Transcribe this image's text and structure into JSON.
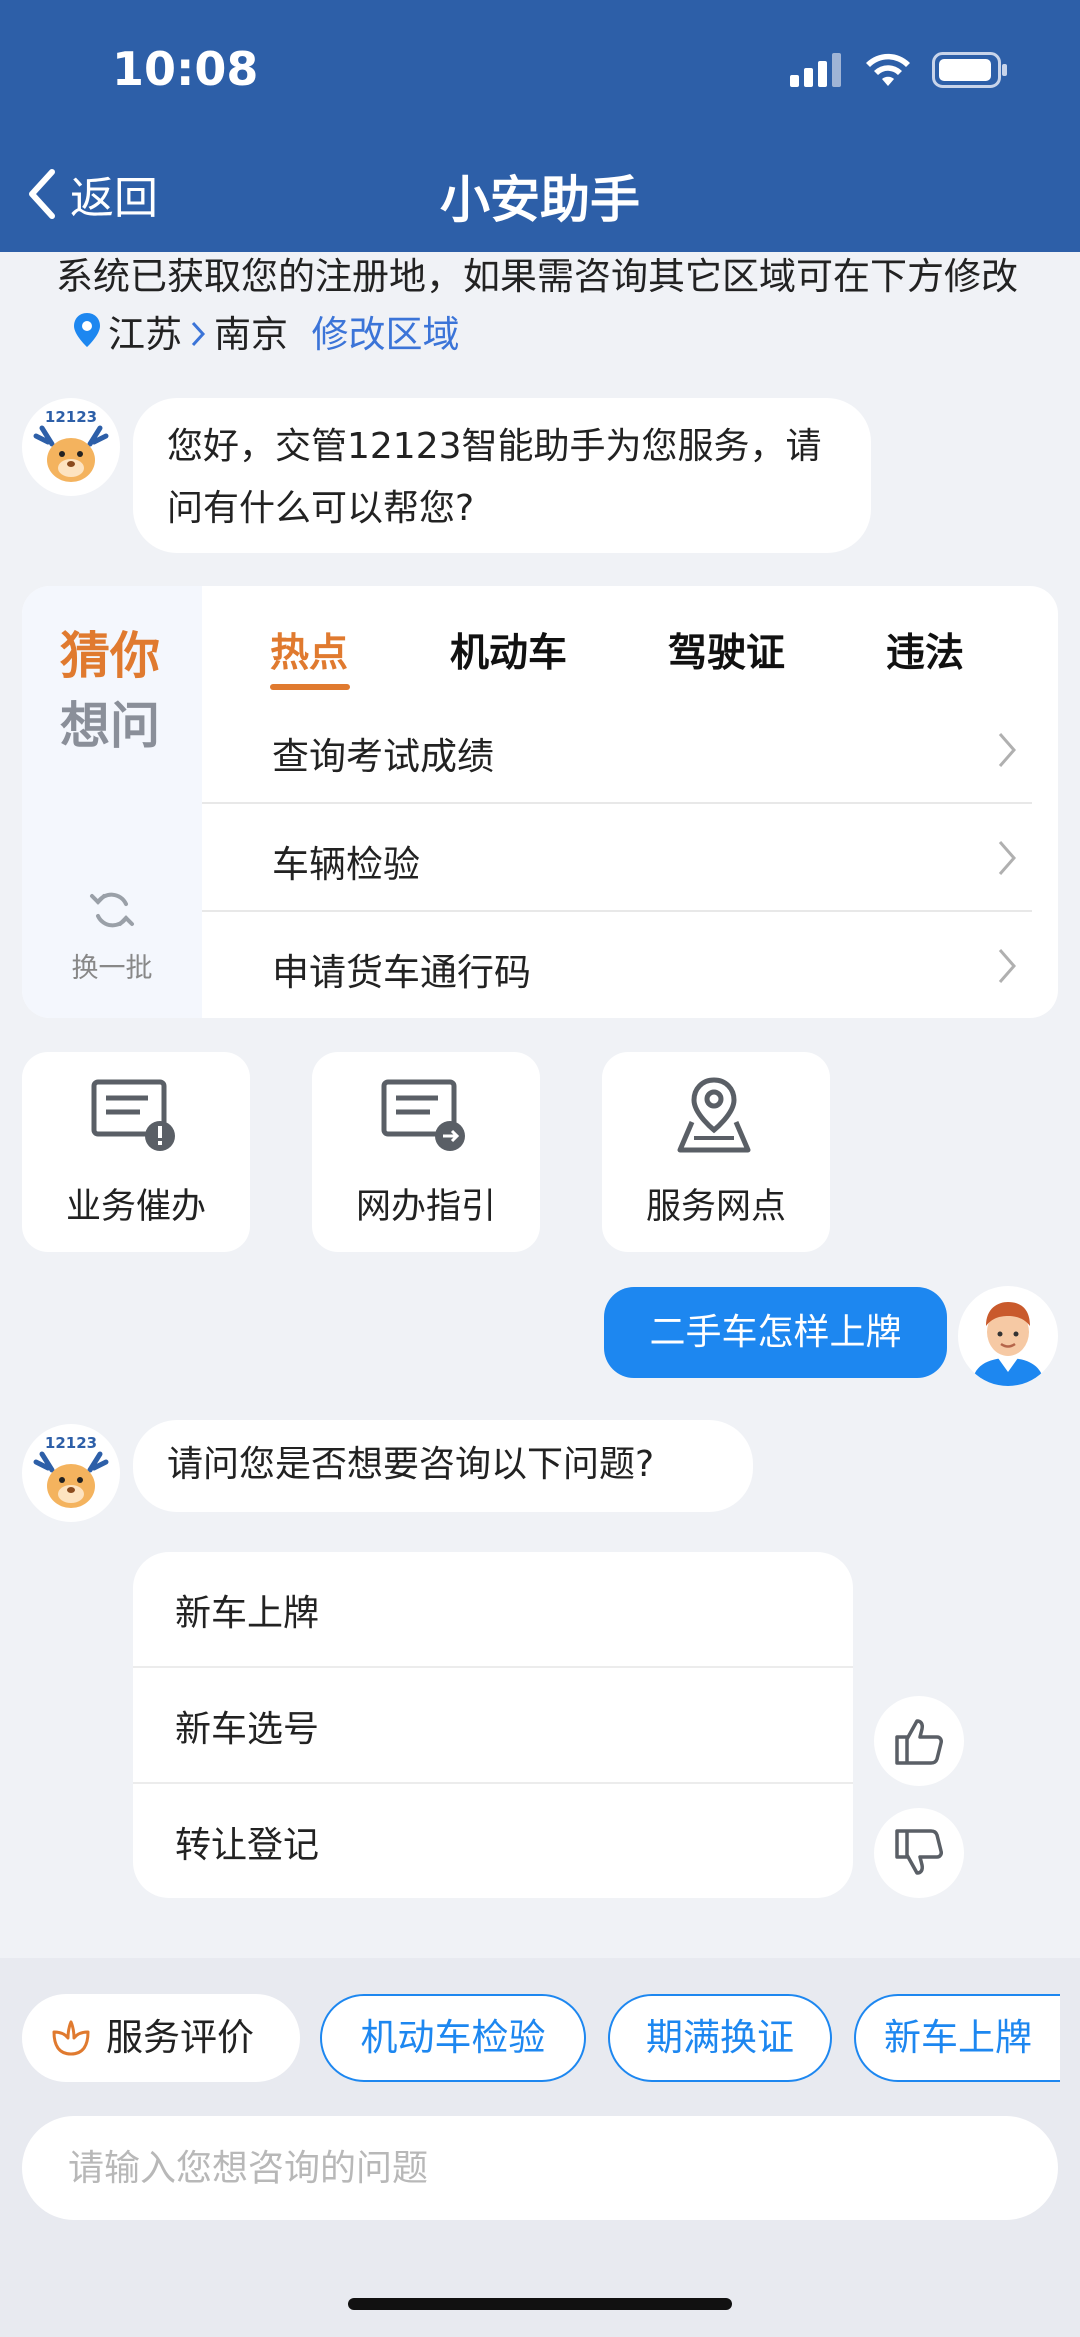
{
  "status_bar": {
    "time": "10:08"
  },
  "nav": {
    "back_label": "返回",
    "title": "小安助手"
  },
  "region_notice": {
    "text": "系统已获取您的注册地，如果需咨询其它区域可在下方修改",
    "province": "江苏",
    "city": "南京",
    "modify_label": "修改区域"
  },
  "bot": {
    "logo_text": "12123",
    "greeting": "您好，交管12123智能助手为您服务，请问有什么可以帮您?"
  },
  "guess_card": {
    "title_line1": "猜你",
    "title_line2": "想问",
    "refresh_label": "换一批",
    "tabs": [
      {
        "label": "热点",
        "active": true
      },
      {
        "label": "机动车",
        "active": false
      },
      {
        "label": "驾驶证",
        "active": false
      },
      {
        "label": "违法",
        "active": false
      }
    ],
    "questions": [
      {
        "text": "查询考试成绩"
      },
      {
        "text": "车辆检验"
      },
      {
        "text": "申请货车通行码"
      }
    ]
  },
  "services": [
    {
      "label": "业务催办",
      "icon": "document-alert-icon"
    },
    {
      "label": "网办指引",
      "icon": "document-forward-icon"
    },
    {
      "label": "服务网点",
      "icon": "map-pin-icon"
    }
  ],
  "user_message": "二手车怎样上牌",
  "bot_reply": "请问您是否想要咨询以下问题?",
  "suggestions": [
    {
      "text": "新车上牌"
    },
    {
      "text": "新车选号"
    },
    {
      "text": "转让登记"
    }
  ],
  "quick_chips": {
    "eval_label": "服务评价",
    "items": [
      "机动车检验",
      "期满换证",
      "新车上牌"
    ]
  },
  "input": {
    "placeholder": "请输入您想咨询的问题"
  },
  "colors": {
    "header_blue": "#2d5fa8",
    "accent_orange": "#e07a2f",
    "link_blue": "#3b74d8",
    "user_bubble_blue": "#1d87f0",
    "page_bg": "#f0f2f6"
  }
}
